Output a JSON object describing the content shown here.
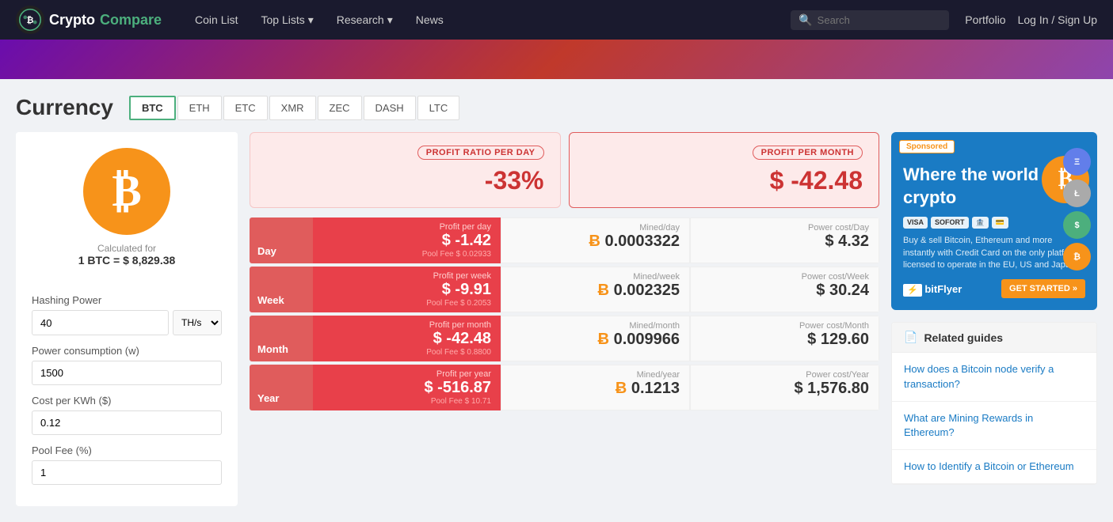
{
  "brand": {
    "name_crypto": "Crypto",
    "name_compare": "Compare",
    "logo_alt": "CryptoCompare Logo"
  },
  "navbar": {
    "coin_list": "Coin List",
    "top_lists": "Top Lists",
    "research": "Research",
    "news": "News",
    "search_placeholder": "Search",
    "portfolio": "Portfolio",
    "login": "Log In / Sign Up"
  },
  "currency": {
    "title": "Currency",
    "tabs": [
      "BTC",
      "ETH",
      "ETC",
      "XMR",
      "ZEC",
      "DASH",
      "LTC"
    ],
    "active_tab": "BTC"
  },
  "calculator": {
    "calculated_for": "Calculated for",
    "btc_price": "1 BTC = $ 8,829.38",
    "hashing_power_label": "Hashing Power",
    "hashing_power_value": "40",
    "hashing_power_unit": "TH/s",
    "power_consumption_label": "Power consumption (w)",
    "power_consumption_value": "1500",
    "cost_per_kwh_label": "Cost per KWh ($)",
    "cost_per_kwh_value": "0.12",
    "pool_fee_label": "Pool Fee (%)",
    "pool_fee_value": "1"
  },
  "profit_ratio": {
    "day_label": "PROFIT RATIO PER DAY",
    "day_value": "-33%",
    "month_label": "PROFIT PER MONTH",
    "month_value": "$ -42.48"
  },
  "rows": [
    {
      "period": "Day",
      "profit_label": "Profit per day",
      "profit_value": "$ -1.42",
      "pool_fee": "Pool Fee $ 0.02933",
      "mined_label": "Mined/day",
      "mined_value": "0.0003322",
      "power_label": "Power cost/Day",
      "power_value": "$ 4.32"
    },
    {
      "period": "Week",
      "profit_label": "Profit per week",
      "profit_value": "$ -9.91",
      "pool_fee": "Pool Fee $ 0.2053",
      "mined_label": "Mined/week",
      "mined_value": "0.002325",
      "power_label": "Power cost/Week",
      "power_value": "$ 30.24"
    },
    {
      "period": "Month",
      "profit_label": "Profit per month",
      "profit_value": "$ -42.48",
      "pool_fee": "Pool Fee $ 0.8800",
      "mined_label": "Mined/month",
      "mined_value": "0.009966",
      "power_label": "Power cost/Month",
      "power_value": "$ 129.60"
    },
    {
      "period": "Year",
      "profit_label": "Profit per year",
      "profit_value": "$ -516.87",
      "pool_fee": "Pool Fee $ 10.71",
      "mined_label": "Mined/year",
      "mined_value": "0.1213",
      "power_label": "Power cost/Year",
      "power_value": "$ 1,576.80"
    }
  ],
  "ad": {
    "sponsored": "Sponsored",
    "headline": "Where the world buys crypto",
    "description": "Buy & sell Bitcoin, Ethereum and more instantly with Credit Card on the only platform licensed to operate in the EU, US and Japan",
    "visa": "VISA",
    "sofort": "SOFORT",
    "get_started": "GET STARTED »",
    "brand": "bitFlyer"
  },
  "related_guides": {
    "title": "Related guides",
    "items": [
      "How does a Bitcoin node verify a transaction?",
      "What are Mining Rewards in Ethereum?",
      "How to Identify a Bitcoin or Ethereum"
    ]
  }
}
